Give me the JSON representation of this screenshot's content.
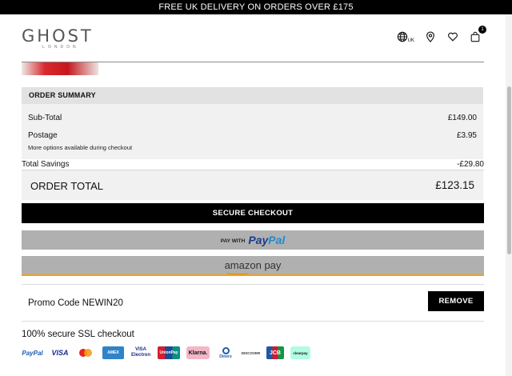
{
  "banner": {
    "text": "FREE UK DELIVERY ON ORDERS OVER £175"
  },
  "header": {
    "logo_main": "GHOST",
    "logo_sub": "LONDON",
    "region_label": "UK",
    "cart_count": "1",
    "icons": [
      "globe-icon",
      "location-pin-icon",
      "heart-icon",
      "shopping-bag-icon"
    ]
  },
  "summary": {
    "heading": "ORDER SUMMARY",
    "subtotal_label": "Sub-Total",
    "subtotal_value": "£149.00",
    "postage_label": "Postage",
    "postage_value": "£3.95",
    "postage_note": "More options available during checkout",
    "savings_label": "Total Savings",
    "savings_value": "-£29.80",
    "total_label": "ORDER TOTAL",
    "total_value": "£123.15"
  },
  "actions": {
    "checkout_label": "SECURE CHECKOUT",
    "paypal_prefix": "PAY WITH",
    "paypal_brand_a": "Pay",
    "paypal_brand_b": "Pal",
    "amazon_label": "amazon pay"
  },
  "promo": {
    "label": "Promo Code NEWIN20",
    "remove_label": "REMOVE"
  },
  "security": {
    "text": "100% secure SSL checkout"
  },
  "payment_methods": {
    "paypal": "PayPal",
    "visa": "VISA",
    "amex": "AMEX",
    "visa_electron_a": "VISA",
    "visa_electron_b": "Electron",
    "unionpay": "UnionPay",
    "klarna": "Klarna.",
    "diners": "Diners",
    "discover": "DISCOVER",
    "jcb": "JCB",
    "clearpay": "clearpay"
  },
  "colors": {
    "brand_black": "#000000",
    "paypal_blue": "#1a3d8f",
    "amazon_orange": "#f2a21b"
  }
}
